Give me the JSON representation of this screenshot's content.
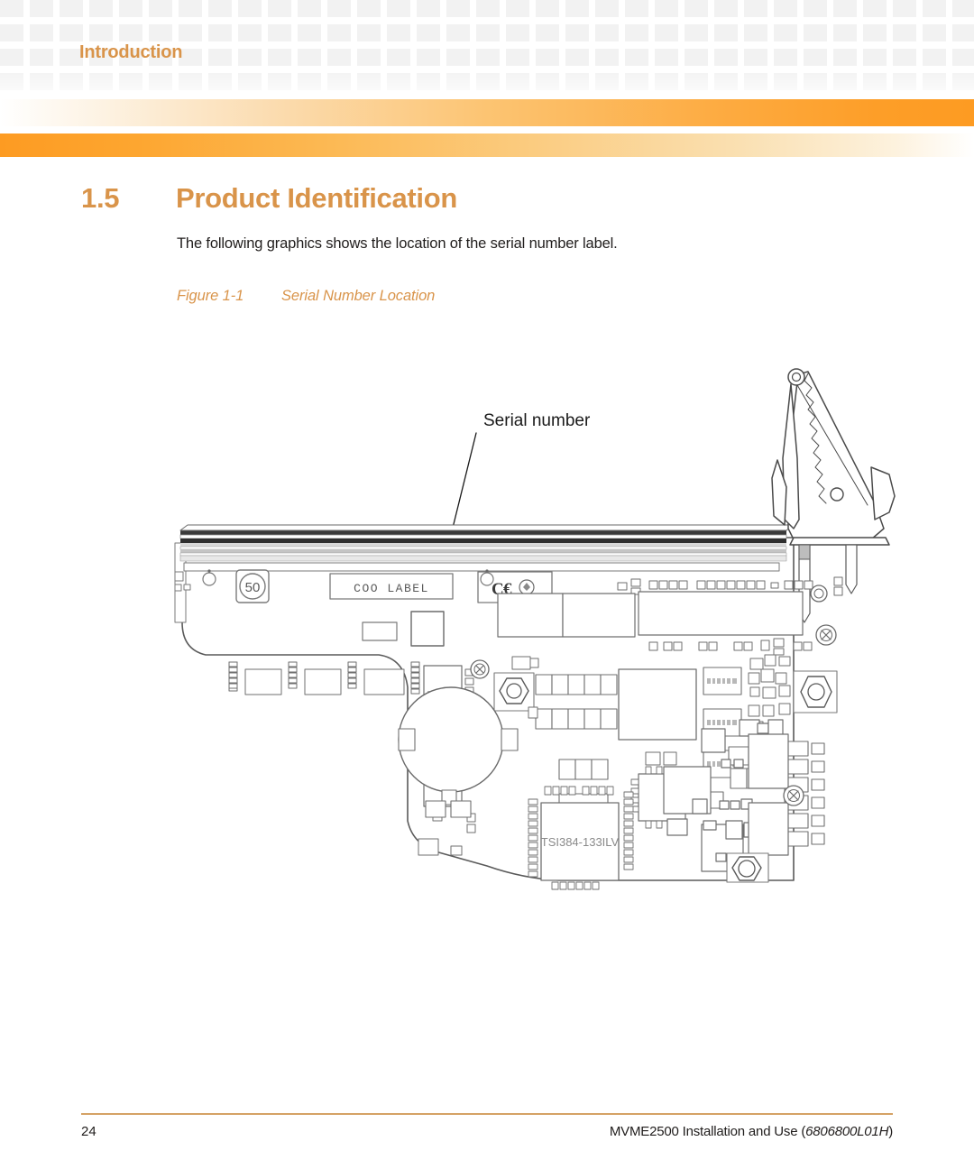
{
  "header": {
    "chapter_title": "Introduction"
  },
  "section": {
    "number": "1.5",
    "title": "Product Identification",
    "paragraph": "The following graphics shows the location of the serial number label."
  },
  "figure": {
    "label": "Figure 1-1",
    "title": "Serial Number Location",
    "callout": "Serial number",
    "board_markings": {
      "coo_label": "COO LABEL",
      "ce_mark": "CE",
      "rohs_mark": "50",
      "main_chip": "TSI384-133ILV"
    }
  },
  "footer": {
    "page_number": "24",
    "document_title": "MVME2500 Installation and Use (",
    "document_code": "6806800L01H",
    "document_title_end": ")"
  },
  "colors": {
    "accent_orange": "#d9944a",
    "bar_orange": "#fd9b22",
    "rule_orange": "#d5a265",
    "grid_gray": "#f2f2f2",
    "text_black": "#201d1c",
    "line_dark": "#3a3a3a",
    "line_mid": "#6f6f6f",
    "line_light": "#9a9a9a"
  }
}
